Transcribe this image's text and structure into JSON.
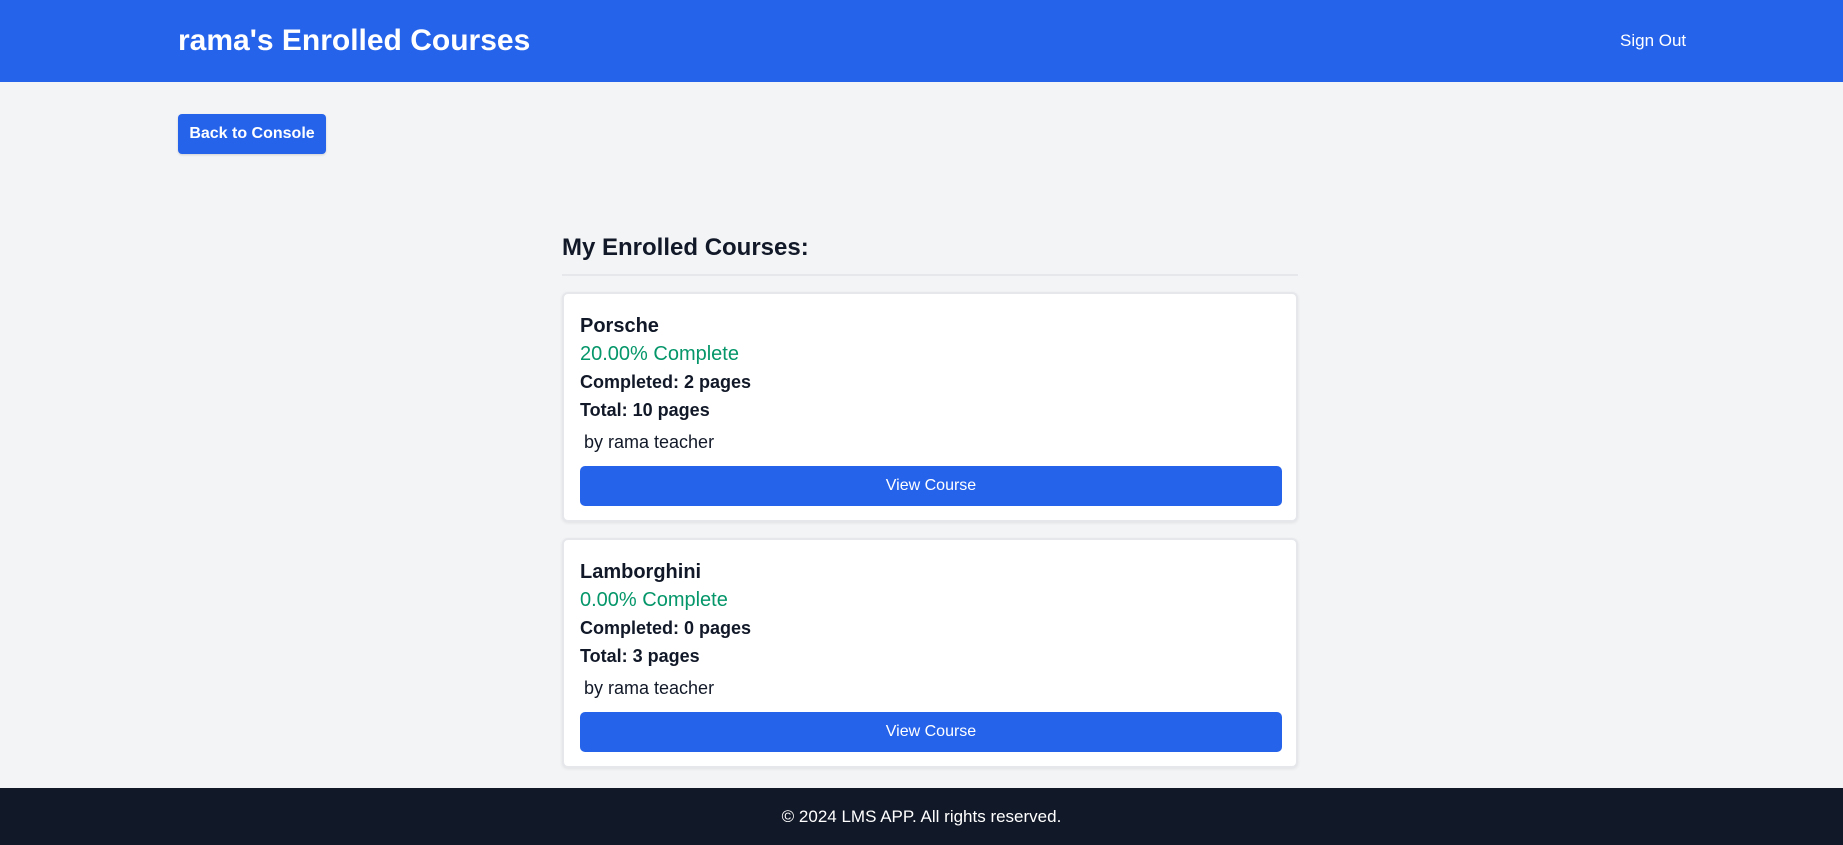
{
  "header": {
    "title": "rama's Enrolled Courses",
    "sign_out_label": "Sign Out"
  },
  "toolbar": {
    "back_label": "Back to Console"
  },
  "main": {
    "section_title": "My Enrolled Courses:",
    "courses": [
      {
        "name": "Porsche",
        "progress": "20.00% Complete",
        "completed": "Completed: 2 pages",
        "total": "Total: 10 pages",
        "author": "by rama teacher",
        "button_label": "View Course"
      },
      {
        "name": "Lamborghini",
        "progress": "0.00% Complete",
        "completed": "Completed: 0 pages",
        "total": "Total: 3 pages",
        "author": "by rama teacher",
        "button_label": "View Course"
      }
    ]
  },
  "footer": {
    "text": "© 2024 LMS APP. All rights reserved."
  },
  "colors": {
    "primary": "#2563eb",
    "success": "#059669",
    "background": "#f3f4f6",
    "footer": "#111827"
  }
}
